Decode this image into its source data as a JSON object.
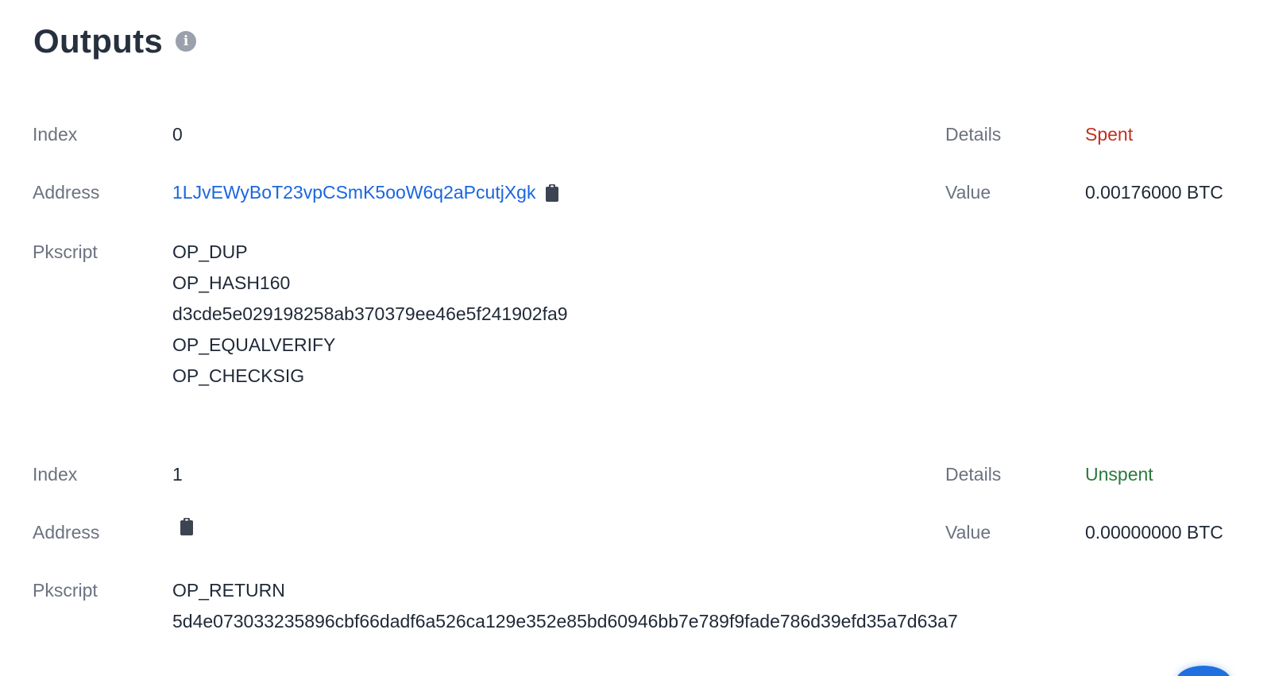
{
  "section": {
    "title": "Outputs",
    "info_icon": "info-icon"
  },
  "outputs": [
    {
      "index_label": "Index",
      "index": "0",
      "details_label": "Details",
      "details": "Spent",
      "details_color": "#c0301e",
      "address_label": "Address",
      "address": "1LJvEWyBoT23vpCSmK5ooW6q2aPcutjXgk",
      "value_label": "Value",
      "value": "0.00176000 BTC",
      "pkscript_label": "Pkscript",
      "pkscript": [
        "OP_DUP",
        "OP_HASH160",
        "d3cde5e029198258ab370379ee46e5f241902fa9",
        "OP_EQUALVERIFY",
        "OP_CHECKSIG"
      ]
    },
    {
      "index_label": "Index",
      "index": "1",
      "details_label": "Details",
      "details": "Unspent",
      "details_color": "#2a7a3e",
      "address_label": "Address",
      "address": "",
      "value_label": "Value",
      "value": "0.00000000 BTC",
      "pkscript_label": "Pkscript",
      "pkscript": [
        "OP_RETURN",
        "5d4e073033235896cbf66dadf6a526ca129e352e85bd60946bb7e789f9fade786d39efd35a7d63a7"
      ]
    }
  ],
  "icons": {
    "copy": "clipboard-icon"
  },
  "colors": {
    "link": "#1a66e0",
    "label": "#6b7280",
    "text": "#1f2937"
  }
}
